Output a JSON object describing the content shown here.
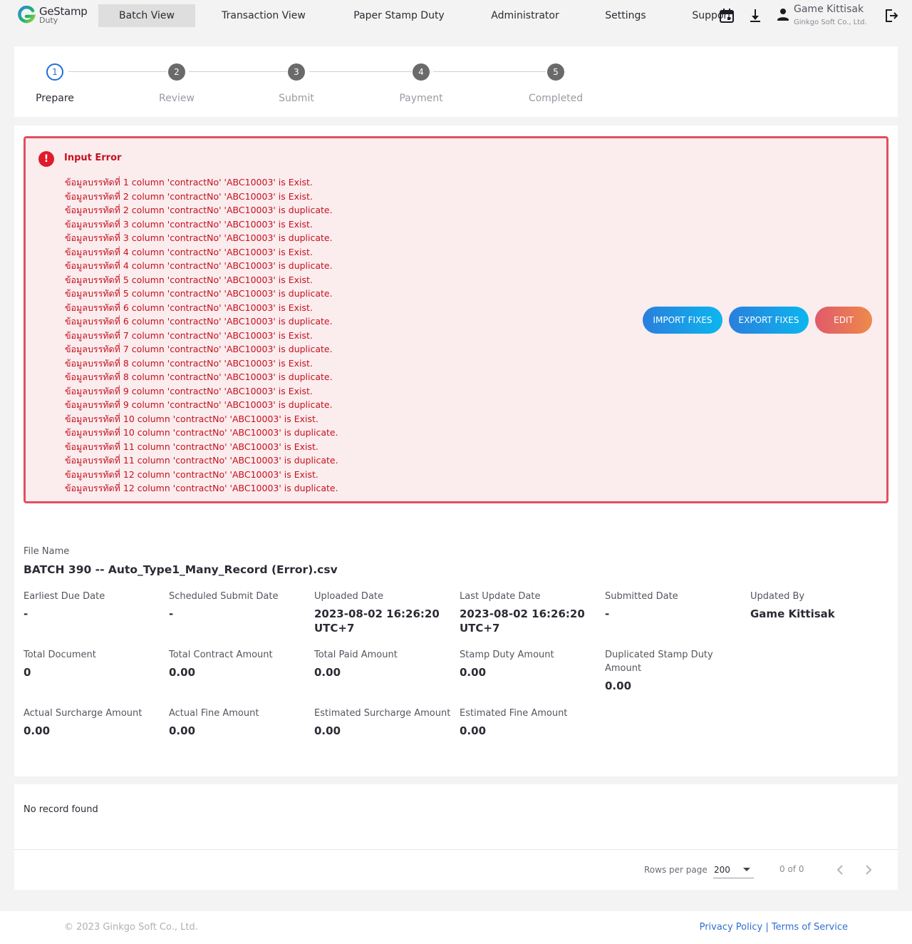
{
  "app": {
    "logo_title": "GeStamp",
    "logo_sub": "Duty"
  },
  "nav": {
    "items": [
      {
        "label": "Batch View",
        "active": true
      },
      {
        "label": "Transaction View"
      },
      {
        "label": "Paper Stamp Duty"
      },
      {
        "label": "Administrator"
      },
      {
        "label": "Settings"
      },
      {
        "label": "Support"
      }
    ],
    "icons": [
      "calendar-icon",
      "download-icon",
      "user-icon",
      "logout-icon"
    ],
    "user_name": "Game Kittisak",
    "user_org": "Ginkgo Soft Co., Ltd."
  },
  "stepper": {
    "steps": [
      {
        "number": "1",
        "label": "Prepare",
        "active": true
      },
      {
        "number": "2",
        "label": "Review"
      },
      {
        "number": "3",
        "label": "Submit"
      },
      {
        "number": "4",
        "label": "Payment"
      },
      {
        "number": "5",
        "label": "Completed"
      }
    ]
  },
  "error": {
    "title": "Input Error",
    "lines": [
      "ข้อมูลบรรทัดที่ 1 column 'contractNo' 'ABC10003' is Exist.",
      "ข้อมูลบรรทัดที่ 2 column 'contractNo' 'ABC10003' is Exist.",
      "ข้อมูลบรรทัดที่ 2 column 'contractNo' 'ABC10003' is duplicate.",
      "ข้อมูลบรรทัดที่ 3 column 'contractNo' 'ABC10003' is Exist.",
      "ข้อมูลบรรทัดที่ 3 column 'contractNo' 'ABC10003' is duplicate.",
      "ข้อมูลบรรทัดที่ 4 column 'contractNo' 'ABC10003' is Exist.",
      "ข้อมูลบรรทัดที่ 4 column 'contractNo' 'ABC10003' is duplicate.",
      "ข้อมูลบรรทัดที่ 5 column 'contractNo' 'ABC10003' is Exist.",
      "ข้อมูลบรรทัดที่ 5 column 'contractNo' 'ABC10003' is duplicate.",
      "ข้อมูลบรรทัดที่ 6 column 'contractNo' 'ABC10003' is Exist.",
      "ข้อมูลบรรทัดที่ 6 column 'contractNo' 'ABC10003' is duplicate.",
      "ข้อมูลบรรทัดที่ 7 column 'contractNo' 'ABC10003' is Exist.",
      "ข้อมูลบรรทัดที่ 7 column 'contractNo' 'ABC10003' is duplicate.",
      "ข้อมูลบรรทัดที่ 8 column 'contractNo' 'ABC10003' is Exist.",
      "ข้อมูลบรรทัดที่ 8 column 'contractNo' 'ABC10003' is duplicate.",
      "ข้อมูลบรรทัดที่ 9 column 'contractNo' 'ABC10003' is Exist.",
      "ข้อมูลบรรทัดที่ 9 column 'contractNo' 'ABC10003' is duplicate.",
      "ข้อมูลบรรทัดที่ 10 column 'contractNo' 'ABC10003' is Exist.",
      "ข้อมูลบรรทัดที่ 10 column 'contractNo' 'ABC10003' is duplicate.",
      "ข้อมูลบรรทัดที่ 11 column 'contractNo' 'ABC10003' is Exist.",
      "ข้อมูลบรรทัดที่ 11 column 'contractNo' 'ABC10003' is duplicate.",
      "ข้อมูลบรรทัดที่ 12 column 'contractNo' 'ABC10003' is Exist.",
      "ข้อมูลบรรทัดที่ 12 column 'contractNo' 'ABC10003' is duplicate."
    ],
    "buttons": {
      "import": "IMPORT FIXES",
      "export": "EXPORT FIXES",
      "edit": "EDIT"
    }
  },
  "details": {
    "file_label": "File Name",
    "file_name": "BATCH  390  -- Auto_Type1_Many_Record (Error).csv",
    "fields": {
      "earliest_due_date": {
        "label": "Earliest Due Date",
        "value": "-"
      },
      "scheduled_submit_date": {
        "label": "Scheduled Submit Date",
        "value": "-"
      },
      "uploaded_date": {
        "label": "Uploaded Date",
        "value_1": "2023-08-02 16:26:20",
        "value_2": "UTC+7"
      },
      "last_update_date": {
        "label": "Last Update Date",
        "value_1": "2023-08-02 16:26:20",
        "value_2": "UTC+7"
      },
      "submitted_date": {
        "label": "Submitted Date",
        "value": "-"
      },
      "updated_by": {
        "label": "Updated By",
        "value": "Game Kittisak"
      },
      "total_document": {
        "label": "Total Document",
        "value": "0"
      },
      "total_contract_amount": {
        "label": "Total Contract Amount",
        "value": "0.00"
      },
      "total_paid_amount": {
        "label": "Total Paid Amount",
        "value": "0.00"
      },
      "stamp_duty_amount": {
        "label": "Stamp Duty Amount",
        "value": "0.00"
      },
      "duplicated_stamp_duty_amount": {
        "label_1": "Duplicated Stamp Duty",
        "label_2": "Amount",
        "value": "0.00"
      },
      "actual_surcharge_amount": {
        "label": "Actual Surcharge Amount",
        "value": "0.00"
      },
      "actual_fine_amount": {
        "label": "Actual Fine Amount",
        "value": "0.00"
      },
      "estimated_surcharge_amount": {
        "label": "Estimated Surcharge Amount",
        "value": "0.00"
      },
      "estimated_fine_amount": {
        "label": "Estimated Fine Amount",
        "value": "0.00"
      }
    }
  },
  "table": {
    "empty_text": "No record found",
    "rows_per_page_label": "Rows per page",
    "rows_per_page_value": "200",
    "page_info": "0 of 0"
  },
  "footer": {
    "copyright": "© 2023 Ginkgo Soft Co., Ltd.",
    "privacy": "Privacy Policy",
    "separator": "|",
    "terms": "Terms of Service"
  },
  "colors": {
    "accent_blue": "#1e6fd9",
    "error_red": "#c4121f",
    "error_bg": "#fbecee",
    "edit_gradient": "#e05a6a",
    "fix_gradient": "#0bb6ef"
  }
}
